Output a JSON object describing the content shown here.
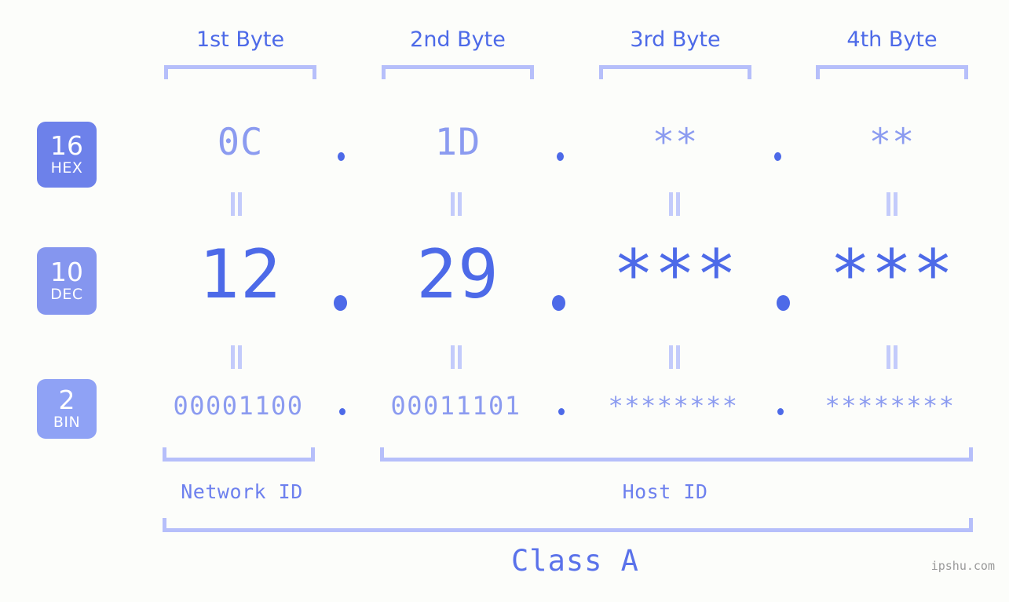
{
  "page": {
    "background": "#fcfdfa",
    "accent_strong": "#4d6ae8",
    "accent_mid": "#8b9bf0",
    "accent_light": "#b6bffa",
    "watermark": "ipshu.com"
  },
  "byte_headers": [
    {
      "label": "1st Byte"
    },
    {
      "label": "2nd Byte"
    },
    {
      "label": "3rd Byte"
    },
    {
      "label": "4th Byte"
    }
  ],
  "bases": [
    {
      "number": "16",
      "name": "HEX",
      "color": "#6d81ea"
    },
    {
      "number": "10",
      "name": "DEC",
      "color": "#8596ef"
    },
    {
      "number": "2",
      "name": "BIN",
      "color": "#8fa2f5"
    }
  ],
  "rows": {
    "hex": {
      "base_number": "16",
      "base_name": "HEX",
      "values": [
        "0C",
        "1D",
        "**",
        "**"
      ],
      "separators": [
        ".",
        ".",
        "."
      ]
    },
    "dec": {
      "base_number": "10",
      "base_name": "DEC",
      "values": [
        "12",
        "29",
        "***",
        "***"
      ],
      "separators": [
        ".",
        ".",
        "."
      ]
    },
    "bin": {
      "base_number": "2",
      "base_name": "BIN",
      "values": [
        "00001100",
        "00011101",
        "********",
        "********"
      ],
      "separators": [
        ".",
        ".",
        "."
      ]
    }
  },
  "equals_separators": {
    "glyph": "=",
    "rotated": "true",
    "count_per_gap": 4
  },
  "id_sections": [
    {
      "label": "Network ID"
    },
    {
      "label": "Host ID"
    }
  ],
  "class": {
    "label": "Class A"
  }
}
